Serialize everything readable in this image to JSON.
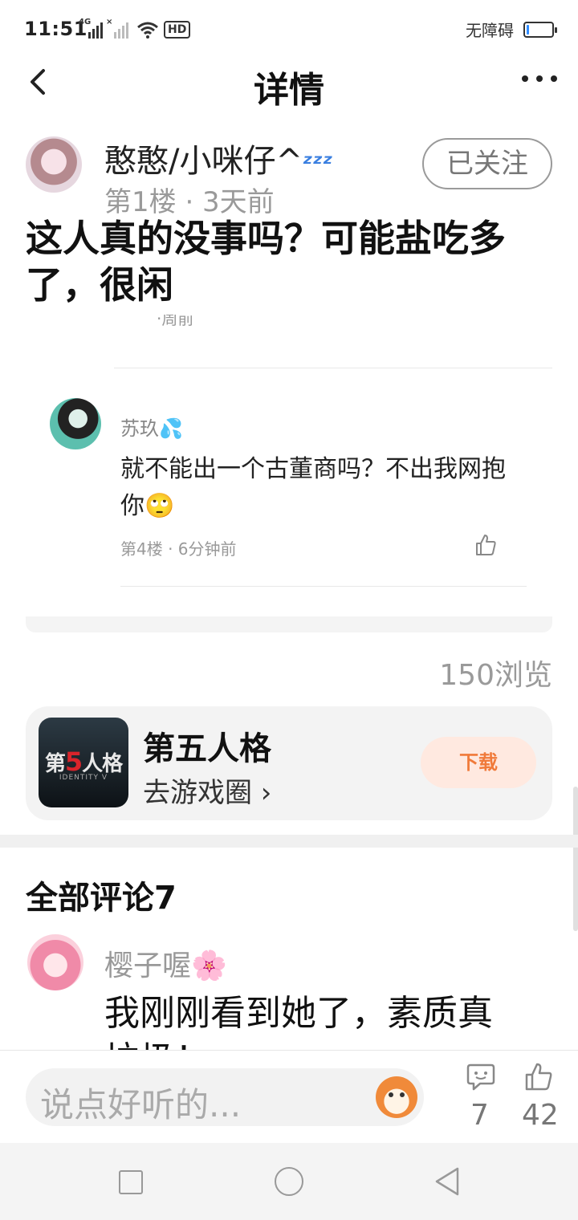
{
  "status_bar": {
    "time": "11:51",
    "net1": "4G",
    "net2": "×",
    "wifi_tag": "HD",
    "accessibility": "无障碍",
    "battery_level_pct": 10
  },
  "header": {
    "title": "详情",
    "back_icon": "chevron-left-icon",
    "more_icon": "more-icon"
  },
  "author": {
    "name": "憨憨/小咪仔^",
    "name_emoji": "ᶻᶻᶻ",
    "meta": "第1楼 · 3天前",
    "follow_label": "已关注"
  },
  "post": {
    "title": "这人真的没事吗？可能盐吃多了，很闲"
  },
  "reply": {
    "name": "苏玖",
    "name_emoji": "💦",
    "text": "就不能出一个古董商吗？不出我网抱你🙄",
    "meta": "第4楼 · 6分钟前"
  },
  "views": "150浏览",
  "game": {
    "logo_prefix": "第",
    "logo_num": "5",
    "logo_suffix": "人格",
    "logo_sub": "IDENTITY V",
    "name": "第五人格",
    "link": "去游戏圈 ›",
    "download_label": "下载"
  },
  "comments": {
    "title": "全部评论7",
    "items": [
      {
        "name": "樱子喔",
        "name_emoji": "🌸",
        "text": "我刚刚看到她了，素质真垃圾！"
      }
    ]
  },
  "input_bar": {
    "placeholder": "说点好听的...",
    "comment_count": "7",
    "like_count": "42"
  },
  "colors": {
    "accent_orange": "#f07a3a",
    "download_bg": "#ffe9e0",
    "muted_text": "#9a9a9a"
  }
}
